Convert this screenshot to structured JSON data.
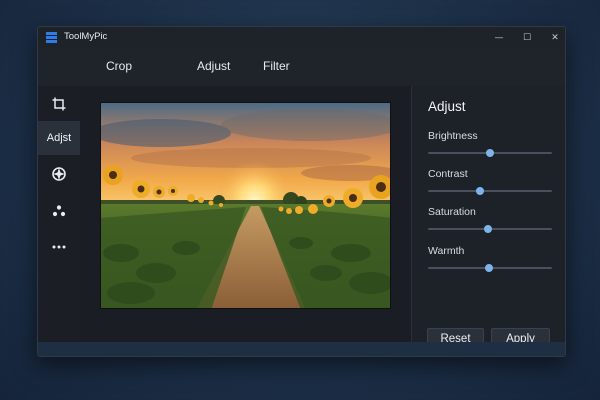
{
  "window": {
    "title": "ToolMyPic",
    "controls": {
      "minimize": "—",
      "maximize": "☐",
      "close": "✕"
    }
  },
  "toolbar": {
    "tabs": [
      {
        "label": "Crop"
      },
      {
        "label": "Adjust"
      },
      {
        "label": "Filter"
      }
    ]
  },
  "sidebar": {
    "items": [
      {
        "icon": "crop-icon"
      },
      {
        "label": "Adjst",
        "active": true
      },
      {
        "icon": "aperture-icon"
      },
      {
        "icon": "dots-cluster-icon"
      },
      {
        "icon": "more-icon"
      }
    ]
  },
  "panel": {
    "title": "Adjust",
    "sliders": [
      {
        "label": "Brightness",
        "value": 0.5
      },
      {
        "label": "Contrast",
        "value": 0.42
      },
      {
        "label": "Saturation",
        "value": 0.48
      },
      {
        "label": "Warmth",
        "value": 0.49
      }
    ],
    "reset_label": "Reset",
    "apply_label": "Apply"
  },
  "colors": {
    "accent": "#7fb4ea",
    "window_bg": "#1b1f26",
    "logo_blue": "#2f7be8"
  }
}
